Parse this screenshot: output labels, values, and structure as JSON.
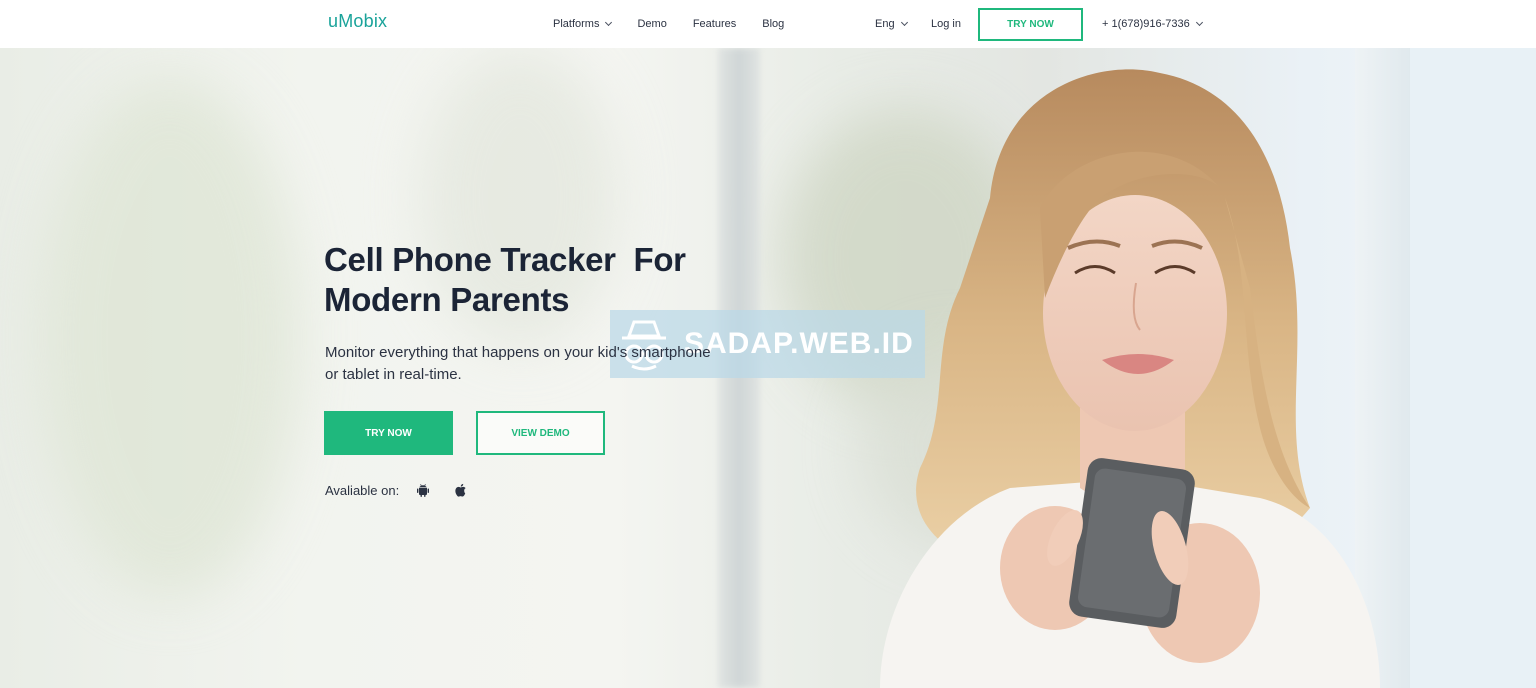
{
  "header": {
    "logo": "uMobix",
    "nav": [
      {
        "label": "Platforms",
        "has_dropdown": true
      },
      {
        "label": "Demo",
        "has_dropdown": false
      },
      {
        "label": "Features",
        "has_dropdown": false
      },
      {
        "label": "Blog",
        "has_dropdown": false
      }
    ],
    "language": "Eng",
    "login": "Log in",
    "try_now": "TRY NOW",
    "phone": "+ 1(678)916-7336"
  },
  "hero": {
    "title_line1": "Cell Phone Tracker  For",
    "title_line2": "Modern Parents",
    "subtitle_line1": "Monitor everything that happens on your kid's smartphone",
    "subtitle_line2": "or tablet in real-time.",
    "try_button": "TRY NOW",
    "demo_button": "VIEW DEMO",
    "available_label": "Avaliable on:",
    "platform_icons": [
      "android-icon",
      "apple-icon"
    ]
  },
  "watermark": {
    "text": "SADAP.WEB.ID",
    "icon": "spy-icon"
  },
  "colors": {
    "brand_green": "#1fb87d",
    "logo_teal": "#1aa39a",
    "heading": "#1b2436"
  }
}
